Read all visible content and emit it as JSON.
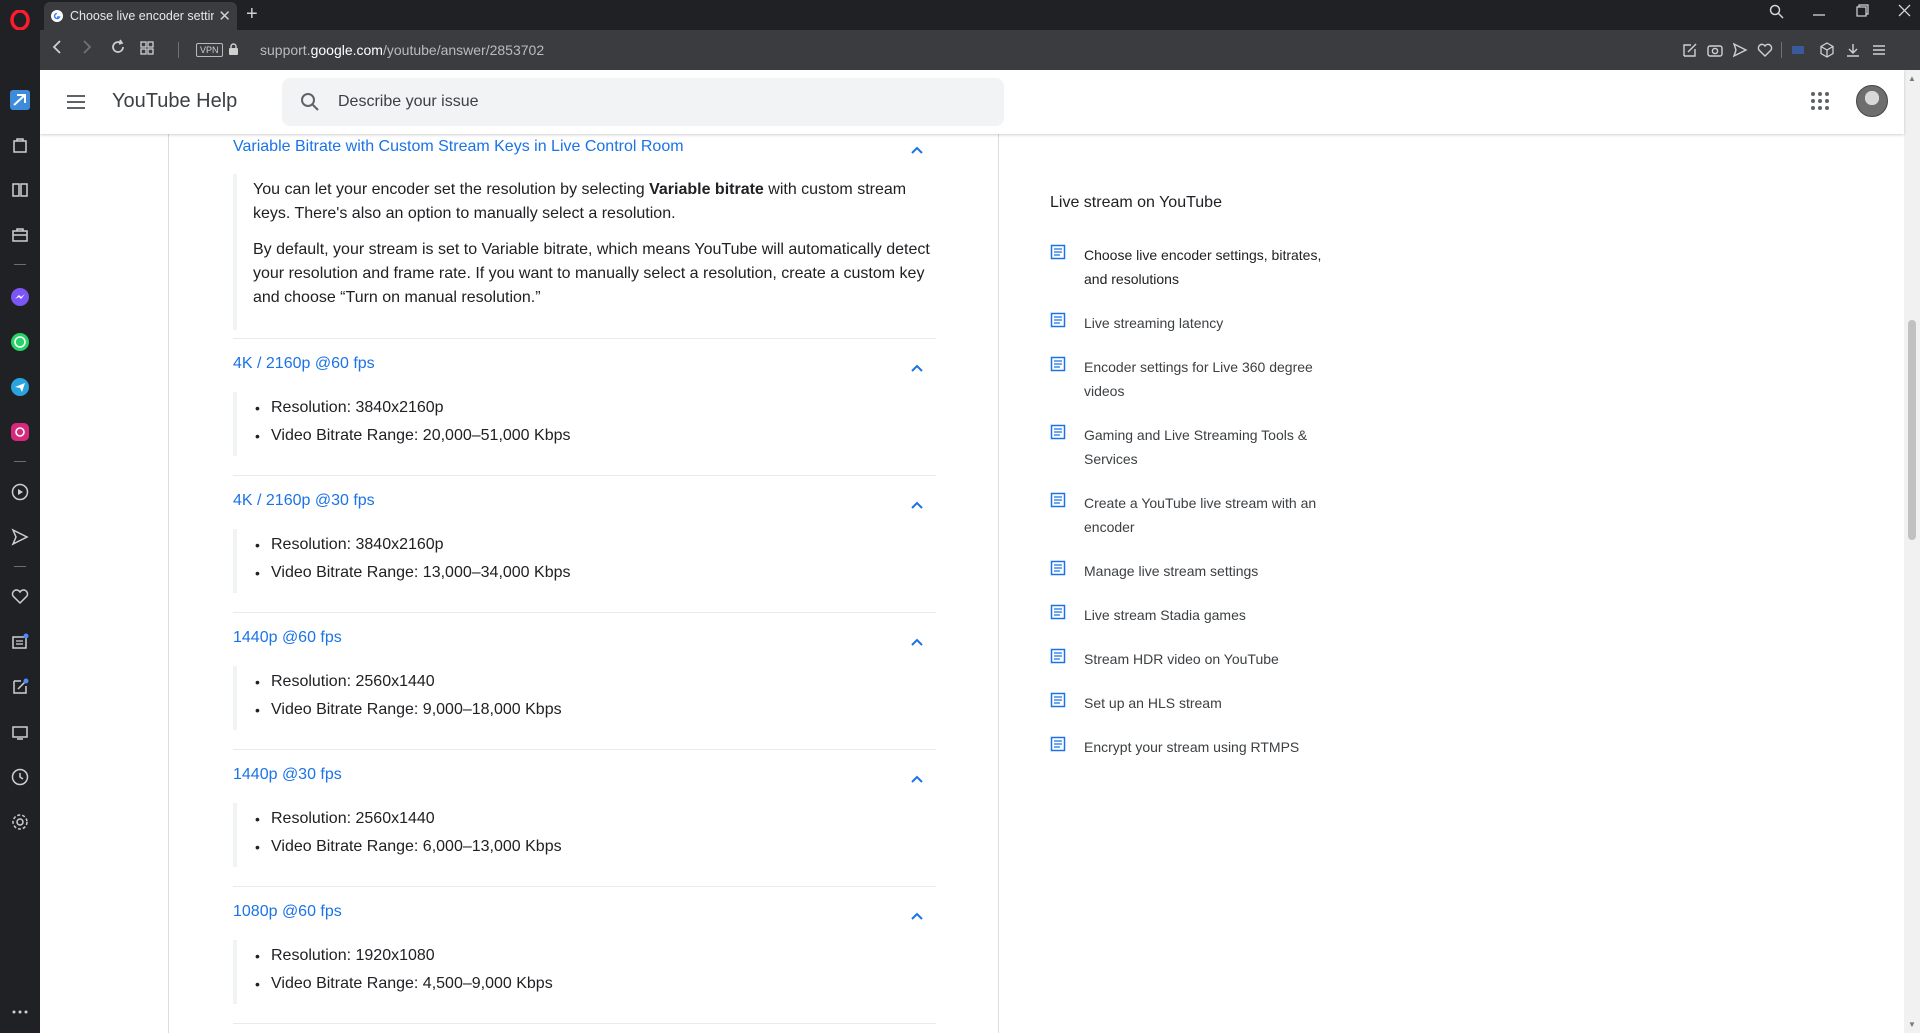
{
  "browser": {
    "tab_title": "Choose live encoder settings, bitrates, and resolutions",
    "url_prefix": "support.",
    "url_domain": "google.com",
    "url_path": "/youtube/answer/2853702",
    "vpn_label": "VPN"
  },
  "header": {
    "site_title": "YouTube Help",
    "search_placeholder": "Describe your issue"
  },
  "article": {
    "sections": [
      {
        "title": "Variable Bitrate with Custom Stream Keys in Live Control Room",
        "para1_pre": "You can let your encoder set the resolution by selecting ",
        "para1_bold": "Variable bitrate",
        "para1_post": " with custom stream keys. There's also an option to manually select a resolution.",
        "para2": "By default, your stream is set to Variable bitrate, which means YouTube will automatically detect your resolution and frame rate. If you want to manually select a resolution, create a custom key and choose “Turn on manual resolution.”"
      },
      {
        "title": "4K / 2160p @60 fps",
        "resolution": "Resolution: 3840x2160p",
        "bitrate": "Video Bitrate Range: 20,000–51,000 Kbps"
      },
      {
        "title": "4K / 2160p @30 fps",
        "resolution": "Resolution: 3840x2160p",
        "bitrate": "Video Bitrate Range: 13,000–34,000 Kbps"
      },
      {
        "title": "1440p @60 fps",
        "resolution": "Resolution: 2560x1440",
        "bitrate": "Video Bitrate Range: 9,000–18,000 Kbps"
      },
      {
        "title": "1440p @30 fps",
        "resolution": "Resolution: 2560x1440",
        "bitrate": "Video Bitrate Range: 6,000–13,000 Kbps"
      },
      {
        "title": "1080p @60 fps",
        "resolution": "Resolution: 1920x1080",
        "bitrate": "Video Bitrate Range: 4,500–9,000 Kbps"
      }
    ]
  },
  "related": {
    "title": "Live stream on YouTube",
    "items": [
      "Choose live encoder settings, bitrates, and resolutions",
      "Live streaming latency",
      "Encoder settings for Live 360 degree videos",
      "Gaming and Live Streaming Tools & Services",
      "Create a YouTube live stream with an encoder",
      "Manage live stream settings",
      "Live stream Stadia games",
      "Stream HDR video on YouTube",
      "Set up an HLS stream",
      "Encrypt your stream using RTMPS"
    ]
  },
  "colors": {
    "link_blue": "#1a73e8",
    "opera_red": "#ff1b2d",
    "browser_dark": "#1f2124",
    "toolbar": "#3a3c40"
  }
}
